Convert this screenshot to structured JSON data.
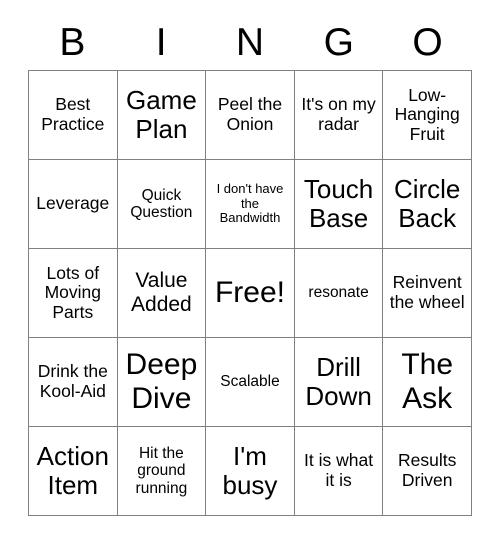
{
  "card": {
    "title": "BINGO",
    "headers": [
      "B",
      "I",
      "N",
      "G",
      "O"
    ],
    "rows": [
      [
        {
          "text": "Best Practice",
          "size": "md"
        },
        {
          "text": "Game Plan",
          "size": "xl"
        },
        {
          "text": "Peel the Onion",
          "size": "md"
        },
        {
          "text": "It's on my radar",
          "size": "md"
        },
        {
          "text": "Low-Hanging Fruit",
          "size": "md"
        }
      ],
      [
        {
          "text": "Leverage",
          "size": "md"
        },
        {
          "text": "Quick Question",
          "size": "sm"
        },
        {
          "text": "I don't have the Bandwidth",
          "size": "xs"
        },
        {
          "text": "Touch Base",
          "size": "xl"
        },
        {
          "text": "Circle Back",
          "size": "xl"
        }
      ],
      [
        {
          "text": "Lots of Moving Parts",
          "size": "md"
        },
        {
          "text": "Value Added",
          "size": "lg"
        },
        {
          "text": "Free!",
          "size": "xxl"
        },
        {
          "text": "resonate",
          "size": "sm"
        },
        {
          "text": "Reinvent the wheel",
          "size": "md"
        }
      ],
      [
        {
          "text": "Drink the Kool-Aid",
          "size": "md"
        },
        {
          "text": "Deep Dive",
          "size": "xxl"
        },
        {
          "text": "Scalable",
          "size": "sm"
        },
        {
          "text": "Drill Down",
          "size": "xl"
        },
        {
          "text": "The Ask",
          "size": "xxl"
        }
      ],
      [
        {
          "text": "Action Item",
          "size": "xl"
        },
        {
          "text": "Hit the ground running",
          "size": "sm"
        },
        {
          "text": "I'm busy",
          "size": "xl"
        },
        {
          "text": "It is what it is",
          "size": "md"
        },
        {
          "text": "Results Driven",
          "size": "md"
        }
      ]
    ],
    "colors": {
      "border": "#808080",
      "text": "#000000",
      "background": "#ffffff"
    }
  }
}
